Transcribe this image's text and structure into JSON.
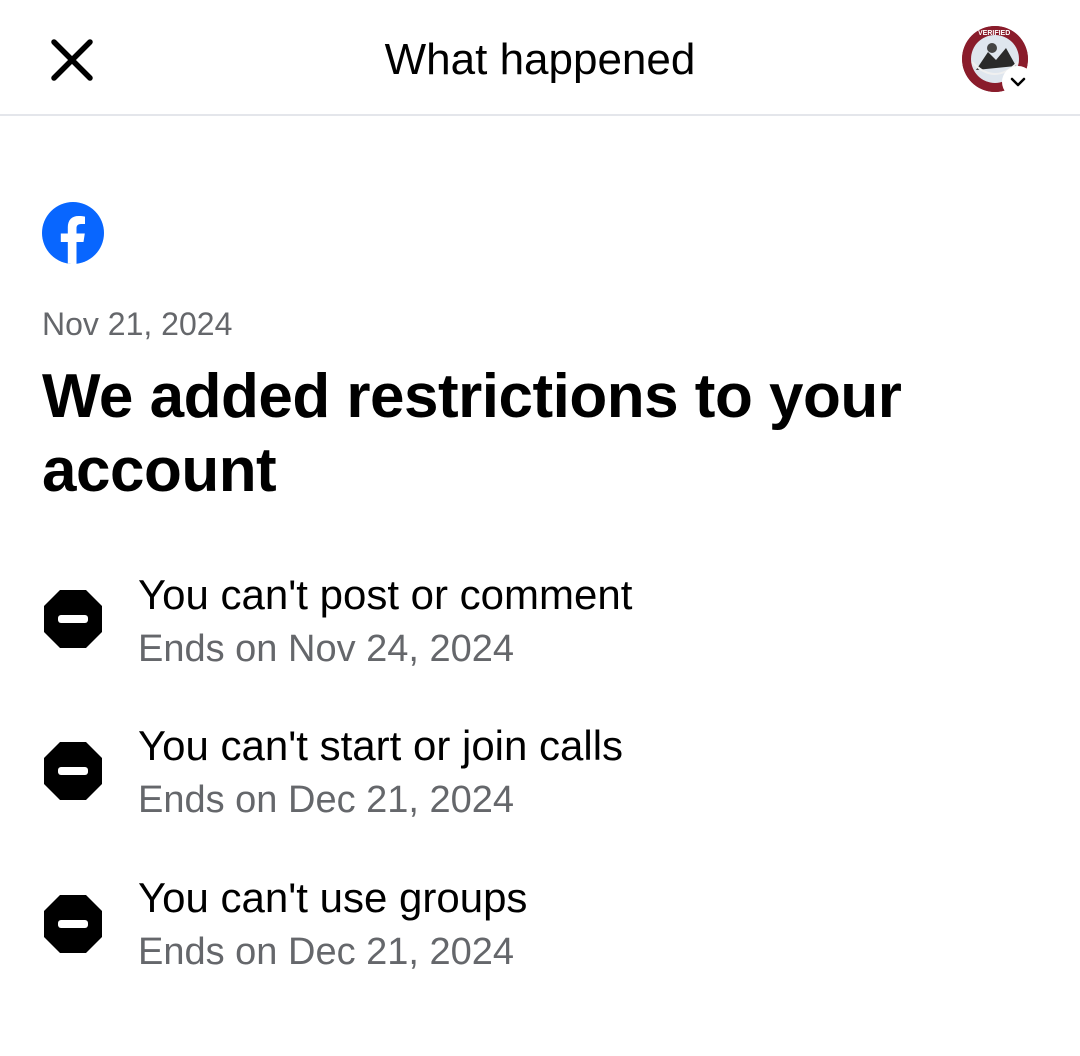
{
  "header": {
    "title": "What happened",
    "close_icon": "close-icon",
    "avatar_badge_text": "VERIFIED",
    "switcher_icon": "chevron-down-icon"
  },
  "content": {
    "brand_icon": "facebook-logo-icon",
    "date": "Nov 21, 2024",
    "headline": "We added restrictions to your account",
    "restrictions": [
      {
        "title": "You can't post or comment",
        "ends": "Ends on Nov 24, 2024",
        "icon": "restricted-icon"
      },
      {
        "title": "You can't start or join calls",
        "ends": "Ends on Dec 21, 2024",
        "icon": "restricted-icon"
      },
      {
        "title": "You can't use groups",
        "ends": "Ends on Dec 21, 2024",
        "icon": "restricted-icon"
      }
    ]
  },
  "colors": {
    "facebook_blue": "#0866ff",
    "secondary_text": "#65676b",
    "divider": "#e4e6eb"
  }
}
